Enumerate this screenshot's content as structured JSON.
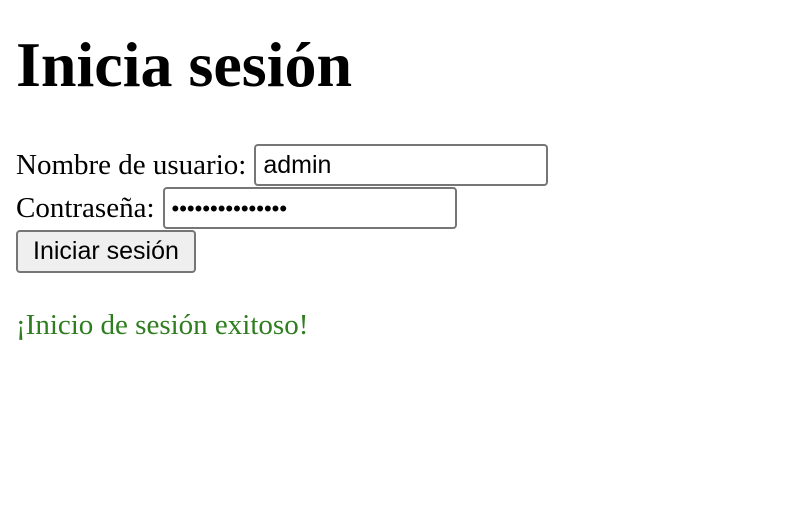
{
  "login": {
    "title": "Inicia sesión",
    "username_label": "Nombre de usuario:",
    "username_value": "admin",
    "password_label": "Contraseña:",
    "password_display": "•••••••••••••••",
    "submit_label": "Iniciar sesión",
    "success_message": "¡Inicio de sesión exitoso!"
  },
  "colors": {
    "success": "#2e7d1f",
    "input_border": "#767676",
    "button_background": "#efefef"
  }
}
